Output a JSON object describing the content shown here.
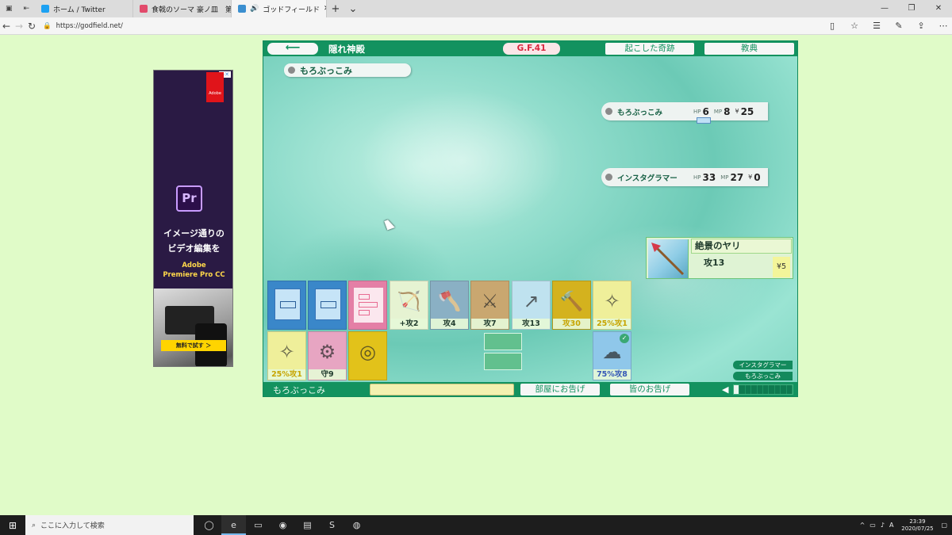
{
  "browser": {
    "tabs": [
      {
        "label": "ホーム / Twitter",
        "icon": "twitter-icon"
      },
      {
        "label": "食戟のソーマ 豪ノ皿　第4話 |",
        "icon": "page-icon"
      },
      {
        "label": "ゴッドフィールド",
        "icon": "godfield-icon",
        "active": true
      }
    ],
    "url": "https://godfield.net/"
  },
  "ad": {
    "badge": "▷✕",
    "brand": "Adobe",
    "app": "Pr",
    "headline_1": "イメージ通りの",
    "headline_2": "ビデオ編集を",
    "product_1": "Adobe",
    "product_2": "Premiere Pro CC",
    "cta": "無料で試す ＞"
  },
  "game": {
    "back_arrow": "⟵",
    "room_name": "隠れ神殿",
    "gf_label": "G.F.41",
    "miracles_button": "起こした奇跡",
    "scripture_button": "教典",
    "my_name": "もろぶっこみ",
    "players": [
      {
        "name": "もろぶっこみ",
        "hp_label": "HP",
        "hp": "6",
        "mp_label": "MP",
        "mp": "8",
        "yen_label": "¥",
        "money": "25"
      },
      {
        "name": "インスタグラマー",
        "hp_label": "HP",
        "hp": "33",
        "mp_label": "MP",
        "mp": "27",
        "yen_label": "¥",
        "money": "0"
      }
    ],
    "detail": {
      "item_name": "絶景のヤリ",
      "stat": "攻13",
      "price": "¥5"
    },
    "hand_row1": [
      {
        "type": "blank",
        "label": ""
      },
      {
        "type": "blank",
        "label": ""
      },
      {
        "type": "pink",
        "label": ""
      },
      {
        "type": "crossbow",
        "label": "+攻2",
        "glyph": "🏹",
        "bg": "#e6f3d2"
      },
      {
        "type": "axe",
        "label": "攻4",
        "glyph": "🪓",
        "bg": "#8ab0c4"
      },
      {
        "type": "swords",
        "label": "攻7",
        "glyph": "⚔",
        "bg": "#c9a770"
      },
      {
        "type": "spear",
        "label": "攻13",
        "glyph": "↗",
        "bg": "#bfe2ef"
      },
      {
        "type": "hammer",
        "label": "攻30",
        "glyph": "🔨",
        "bg": "#d4b21e",
        "color": "yellow"
      },
      {
        "type": "bow",
        "label": "25%攻1",
        "glyph": "✧",
        "bg": "#efef9a",
        "color": "yellow"
      }
    ],
    "hand_row2": [
      {
        "type": "bow",
        "label": "25%攻1",
        "glyph": "✧",
        "bg": "#efef9a",
        "color": "yellow"
      },
      {
        "type": "shield",
        "label": "守9",
        "glyph": "⚙",
        "bg": "#e7a5c2"
      },
      {
        "type": "gold",
        "label": "",
        "glyph": "◎",
        "bg": "#e2c21a"
      },
      {
        "type": "sky",
        "label": "75%攻8",
        "glyph": "☁",
        "bg": "#8fc7ea",
        "color": "blue",
        "checked": true
      }
    ],
    "check_mark": "✓",
    "turn_order": [
      "インスタグラマー",
      "もろぶっこみ"
    ],
    "bottom": {
      "me": "もろぶっこみ",
      "room_notice_button": "部屋にお告げ",
      "all_notice_button": "皆のお告げ",
      "volume_level": 0.1
    }
  },
  "taskbar": {
    "search_placeholder": "ここに入力して検索",
    "time": "23:39",
    "date": "2020/07/25"
  }
}
